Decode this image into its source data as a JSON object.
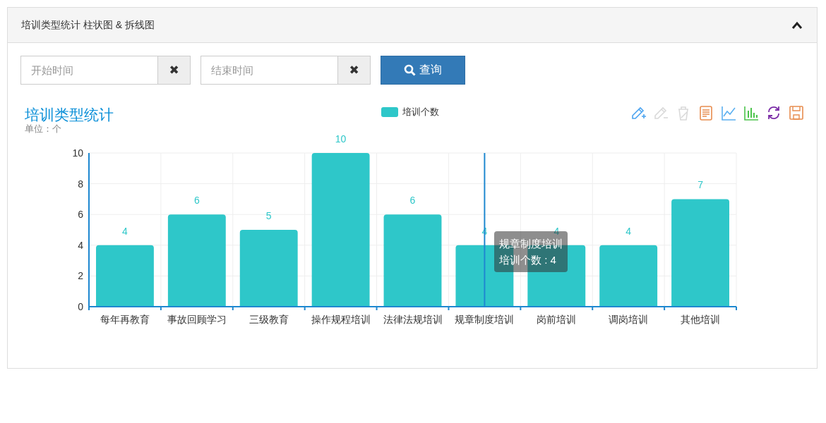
{
  "panel": {
    "title": "培训类型统计 柱状图 & 拆线图",
    "expanded": true
  },
  "filters": [
    {
      "placeholder": "开始时间",
      "clear": "✖"
    },
    {
      "placeholder": "结束时间",
      "clear": "✖"
    }
  ],
  "query_button": {
    "label": "查询"
  },
  "chart": {
    "title": "培训类型统计",
    "subtitle": "单位：个",
    "toolbox": [
      {
        "kind": "zoom",
        "disabled": false
      },
      {
        "kind": "zoom-reset",
        "disabled": true
      },
      {
        "kind": "clear",
        "disabled": true
      },
      {
        "kind": "data-view",
        "disabled": false
      },
      {
        "kind": "line",
        "disabled": false
      },
      {
        "kind": "bar",
        "disabled": false
      },
      {
        "kind": "restore",
        "disabled": false
      },
      {
        "kind": "save",
        "disabled": false
      }
    ],
    "tooltip": {
      "title": "规章制度培训",
      "text": "培训个数 : 4"
    },
    "chart_data": {
      "type": "bar",
      "categories": [
        "每年再教育",
        "事故回顾学习",
        "三级教育",
        "操作规程培训",
        "法律法规培训",
        "规章制度培训",
        "岗前培训",
        "调岗培训",
        "其他培训"
      ],
      "series": [
        {
          "name": "培训个数",
          "color": "#2ec7c9",
          "values": [
            4,
            6,
            5,
            10,
            6,
            4,
            4,
            4,
            7
          ]
        }
      ],
      "ylim": [
        0,
        10
      ],
      "yticks": [
        0,
        2,
        4,
        6,
        8,
        10
      ],
      "grid": true,
      "data_labels": true,
      "ref_lines": [
        {
          "axis": "x",
          "value": "规章制度培训",
          "color": "#1e88d0"
        }
      ]
    }
  }
}
